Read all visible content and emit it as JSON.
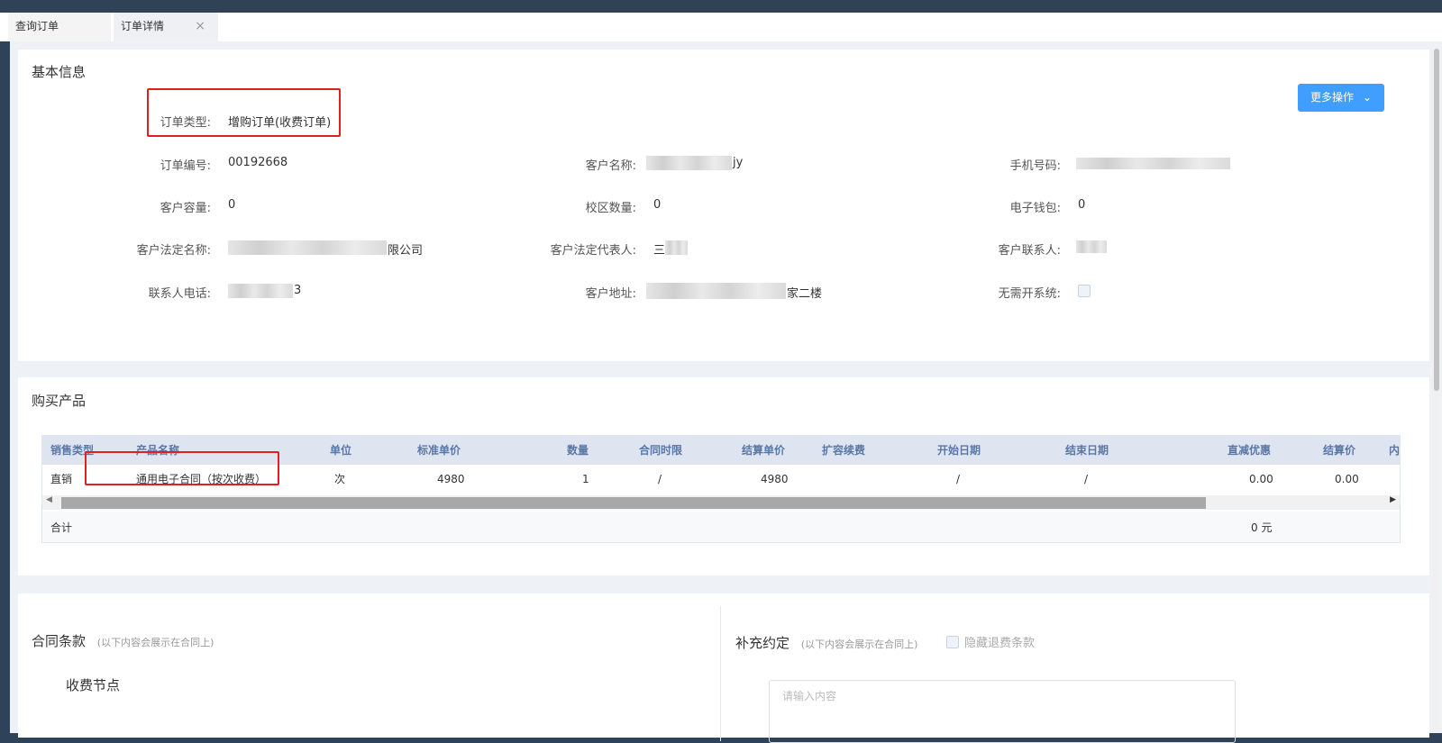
{
  "tabs": [
    {
      "label": "查询订单"
    },
    {
      "label": "订单详情",
      "close": "×"
    }
  ],
  "basic_info": {
    "title": "基本信息",
    "more_button": "更多操作",
    "order_type_label": "订单类型:",
    "order_type_value": "增购订单(收费订单)",
    "order_no_label": "订单编号:",
    "order_no_value": "00192668",
    "customer_name_label": "客户名称:",
    "customer_name_suffix": "jy",
    "phone_label": "手机号码:",
    "capacity_label": "客户容量:",
    "capacity_value": "0",
    "campus_count_label": "校区数量:",
    "campus_count_value": "0",
    "wallet_label": "电子钱包:",
    "wallet_value": "0",
    "legal_name_label": "客户法定名称:",
    "legal_name_suffix": "限公司",
    "legal_rep_label": "客户法定代表人:",
    "legal_rep_prefix": "三",
    "contact_label": "客户联系人:",
    "contact_phone_label": "联系人电话:",
    "contact_phone_suffix": "3",
    "address_label": "客户地址:",
    "address_suffix": "家二楼",
    "no_system_label": "无需开系统:"
  },
  "products": {
    "title": "购买产品",
    "columns": [
      "销售类型",
      "产品名称",
      "单位",
      "标准单价",
      "数量",
      "合同时限",
      "结算单价",
      "扩容续费",
      "开始日期",
      "结束日期",
      "直减优惠",
      "结算价",
      "内"
    ],
    "rows": [
      {
        "sale_type": "直销",
        "product": "通用电子合同（按次收费）",
        "unit": "次",
        "std_price": "4980",
        "qty": "1",
        "term": "/",
        "settle_price": "4980",
        "renew": "",
        "start": "/",
        "end": "/",
        "discount": "0.00",
        "settle": "0.00"
      }
    ],
    "total_label": "合计",
    "total_value": "0 元"
  },
  "contract": {
    "title": "合同条款",
    "hint": "(以下内容会展示在合同上)",
    "fee_node_title": "收费节点"
  },
  "supplement": {
    "title": "补充约定",
    "hint": "(以下内容会展示在合同上)",
    "hide_refund_label": "隐藏退费条款",
    "placeholder": "请输入内容"
  }
}
